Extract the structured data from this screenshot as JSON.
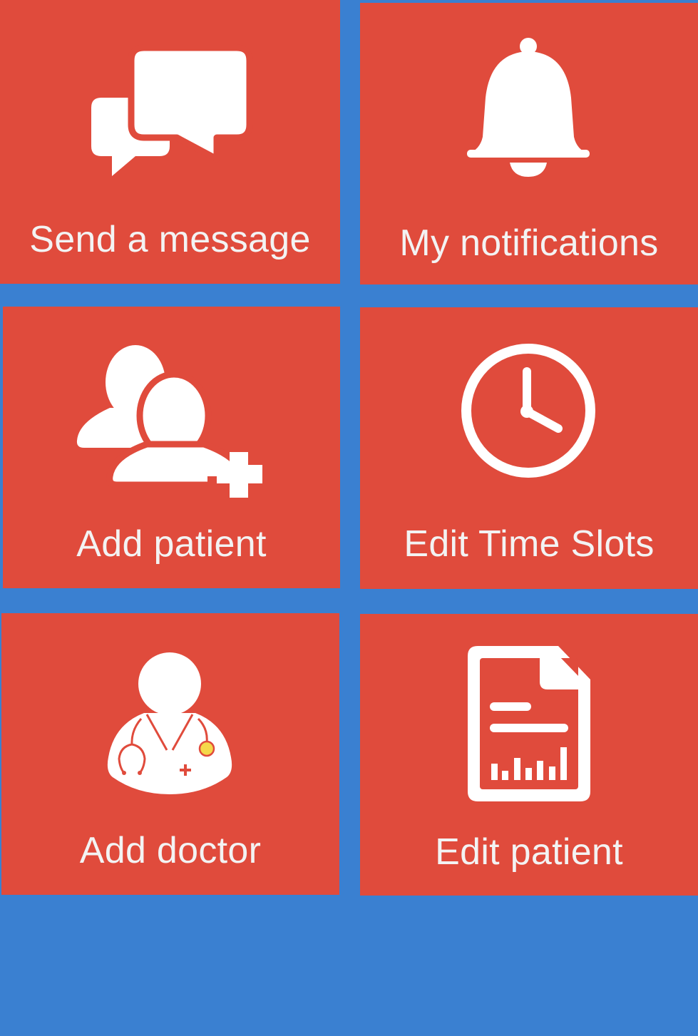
{
  "colors": {
    "background": "#3a80d1",
    "tile": "#e04b3c",
    "icon": "#ffffff",
    "label": "#f3f3f3",
    "stethoscope_accent": "#f5d84a"
  },
  "tiles": [
    {
      "label": "Send a message",
      "icon": "chat-bubbles-icon"
    },
    {
      "label": "My notifications",
      "icon": "bell-icon"
    },
    {
      "label": "Add patient",
      "icon": "add-user-icon"
    },
    {
      "label": "Edit Time Slots",
      "icon": "clock-icon"
    },
    {
      "label": "Add doctor",
      "icon": "doctor-icon"
    },
    {
      "label": "Edit patient",
      "icon": "report-document-icon"
    }
  ]
}
